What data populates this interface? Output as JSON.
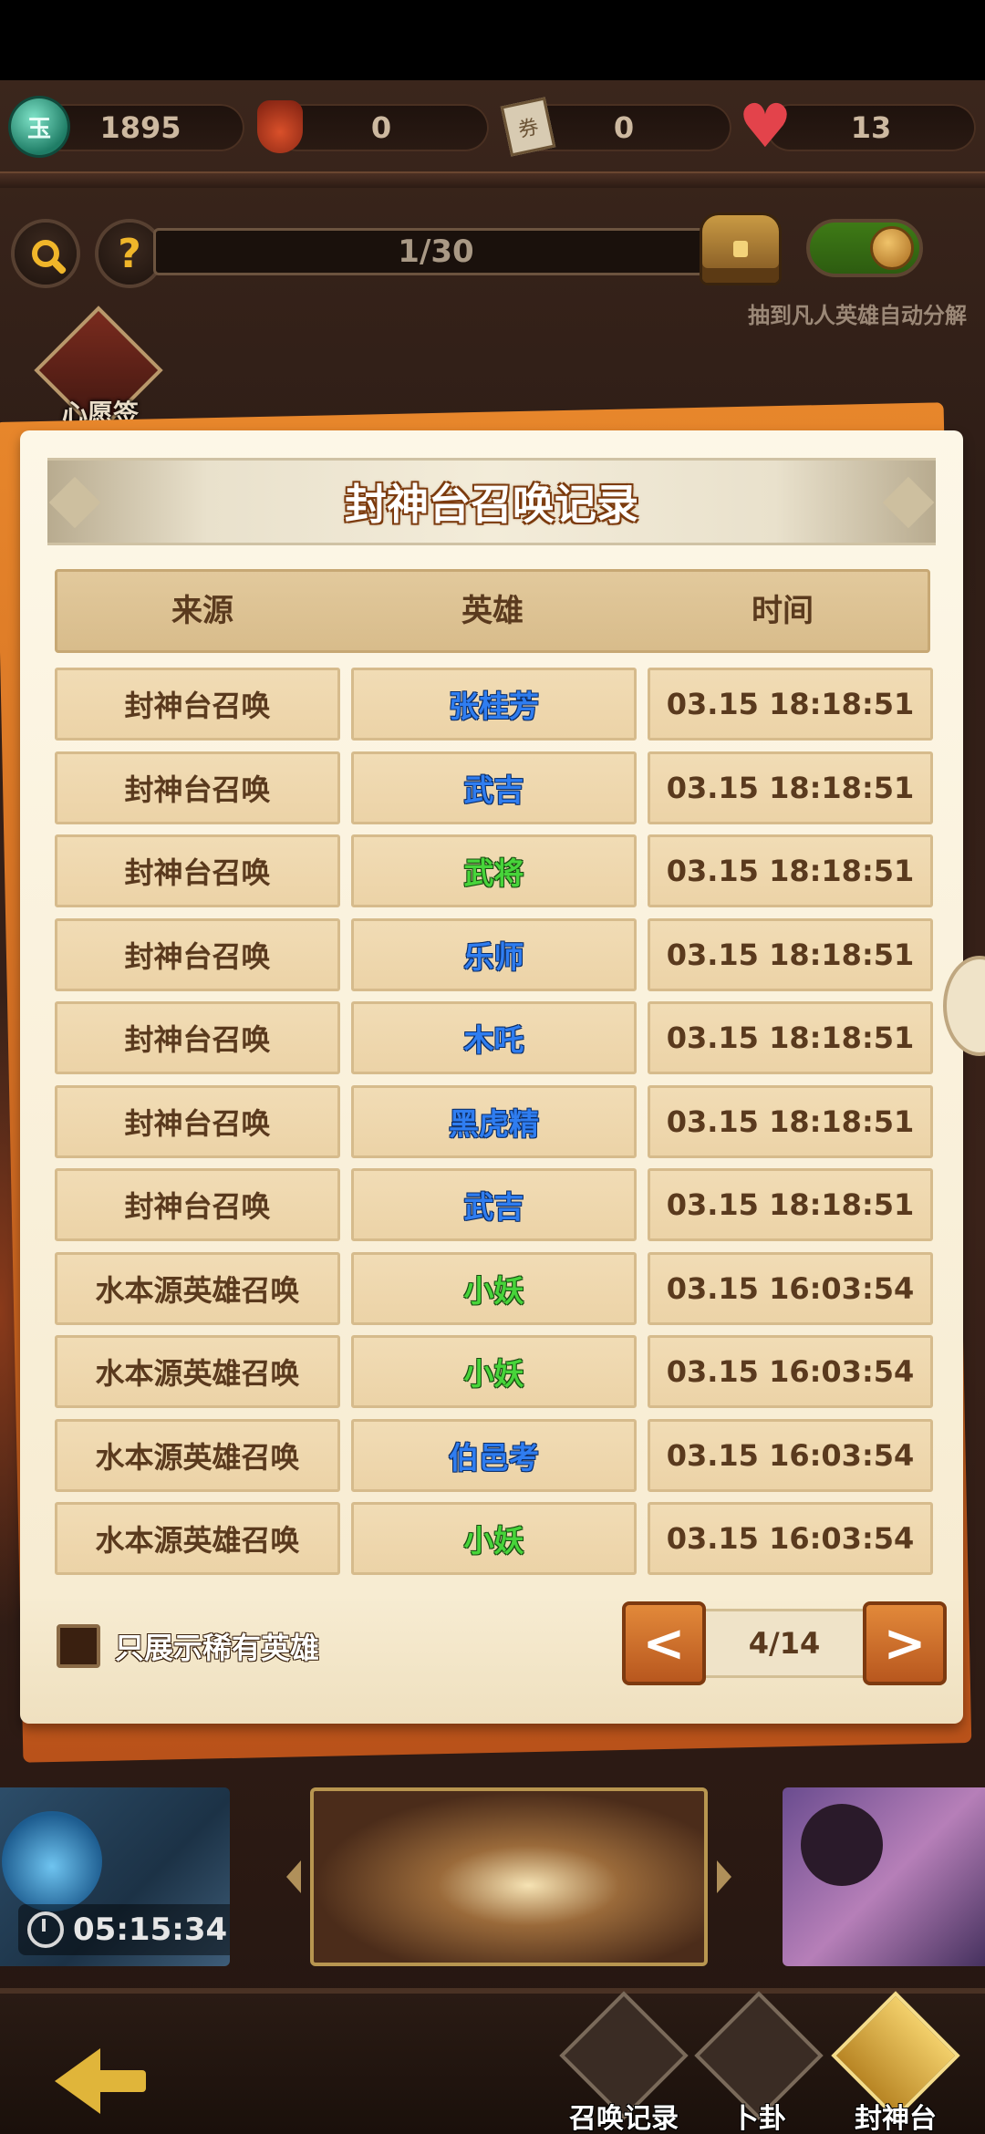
{
  "resources": [
    {
      "icon": "coin-icon",
      "value": "1895"
    },
    {
      "icon": "red-bag-icon",
      "value": "0"
    },
    {
      "icon": "ticket-icon",
      "value": "0"
    },
    {
      "icon": "heart-icon",
      "value": "13"
    }
  ],
  "coin_symbol": "玉",
  "ticket_symbol": "券",
  "progress": {
    "text": "1/30",
    "value": 1,
    "max": 30
  },
  "auto_decompose": {
    "label": "抽到凡人英雄自动分解",
    "enabled": true
  },
  "wish": {
    "label": "心愿签"
  },
  "dialog": {
    "title": "封神台召唤记录",
    "headers": {
      "source": "来源",
      "hero": "英雄",
      "time": "时间"
    },
    "rows": [
      {
        "source": "封神台召唤",
        "hero": "张桂芳",
        "time": "03.15 18:18:51",
        "rarity": "blue"
      },
      {
        "source": "封神台召唤",
        "hero": "武吉",
        "time": "03.15 18:18:51",
        "rarity": "blue"
      },
      {
        "source": "封神台召唤",
        "hero": "武将",
        "time": "03.15 18:18:51",
        "rarity": "green"
      },
      {
        "source": "封神台召唤",
        "hero": "乐师",
        "time": "03.15 18:18:51",
        "rarity": "blue"
      },
      {
        "source": "封神台召唤",
        "hero": "木吒",
        "time": "03.15 18:18:51",
        "rarity": "blue"
      },
      {
        "source": "封神台召唤",
        "hero": "黑虎精",
        "time": "03.15 18:18:51",
        "rarity": "blue"
      },
      {
        "source": "封神台召唤",
        "hero": "武吉",
        "time": "03.15 18:18:51",
        "rarity": "blue"
      },
      {
        "source": "水本源英雄召唤",
        "hero": "小妖",
        "time": "03.15 16:03:54",
        "rarity": "green"
      },
      {
        "source": "水本源英雄召唤",
        "hero": "小妖",
        "time": "03.15 16:03:54",
        "rarity": "green"
      },
      {
        "source": "水本源英雄召唤",
        "hero": "伯邑考",
        "time": "03.15 16:03:54",
        "rarity": "blue"
      },
      {
        "source": "水本源英雄召唤",
        "hero": "小妖",
        "time": "03.15 16:03:54",
        "rarity": "green"
      }
    ],
    "filter": {
      "label": "只展示稀有英雄",
      "checked": false
    },
    "pager": {
      "text": "4/14",
      "prev": "<",
      "next": ">"
    }
  },
  "pool": {
    "timer": "05:15:34"
  },
  "nav": [
    {
      "label": "",
      "icon": "back-arrow-icon"
    },
    {
      "label": "召唤记录",
      "icon": "record-scroll-icon"
    },
    {
      "label": "卜卦",
      "icon": "yin-yang-icon"
    },
    {
      "label": "封神台",
      "icon": "fengshen-scroll-icon",
      "active": true
    }
  ],
  "colors": {
    "hero_blue": "#2f7df0",
    "hero_green": "#47d43a",
    "accent_orange": "#d9752a"
  }
}
